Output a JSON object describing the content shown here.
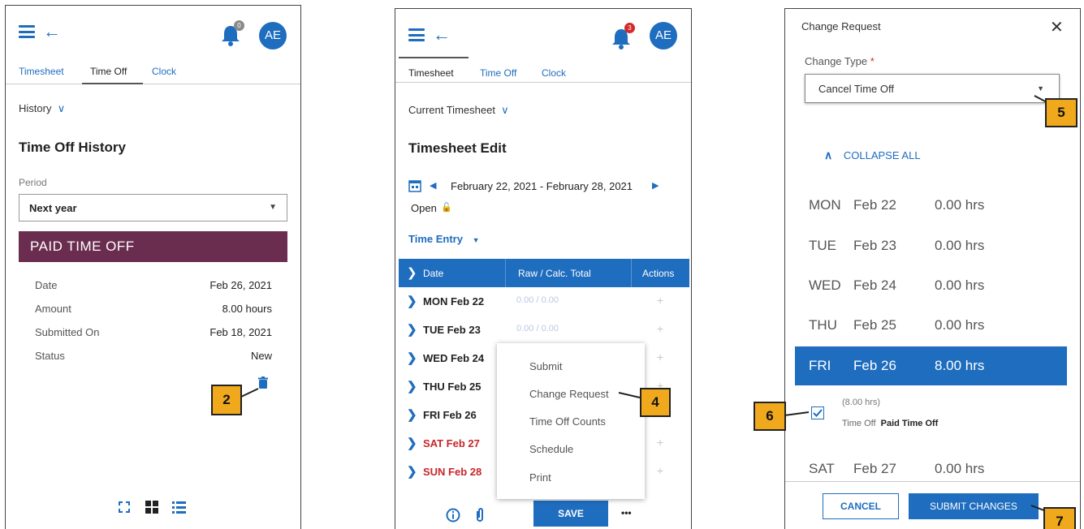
{
  "panel1": {
    "avatar": "AE",
    "bell_badge": "0",
    "tabs": [
      "Timesheet",
      "Time Off",
      "Clock"
    ],
    "history_label": "History",
    "title": "Time Off History",
    "period_label": "Period",
    "period_value": "Next year",
    "card_title": "PAID TIME OFF",
    "details": [
      {
        "label": "Date",
        "value": "Feb 26, 2021"
      },
      {
        "label": "Amount",
        "value": "8.00 hours"
      },
      {
        "label": "Submitted On",
        "value": "Feb 18, 2021"
      },
      {
        "label": "Status",
        "value": "New"
      }
    ],
    "callout": "2"
  },
  "panel2": {
    "avatar": "AE",
    "bell_badge": "3",
    "tabs": [
      "Timesheet",
      "Time Off",
      "Clock"
    ],
    "current_label": "Current Timesheet",
    "title": "Timesheet Edit",
    "date_range": "February 22, 2021 - February 28, 2021",
    "status": "Open",
    "time_entry": "Time Entry",
    "columns": [
      "Date",
      "Raw / Calc. Total",
      "Actions"
    ],
    "rows": [
      {
        "day": "MON Feb 22",
        "total": "0.00 / 0.00"
      },
      {
        "day": "TUE Feb 23",
        "total": "0.00 / 0.00"
      },
      {
        "day": "WED Feb 24",
        "total": ""
      },
      {
        "day": "THU Feb 25",
        "total": ""
      },
      {
        "day": "FRI Feb 26",
        "total": ""
      },
      {
        "day": "SAT Feb 27",
        "total": ""
      },
      {
        "day": "SUN Feb 28",
        "total": ""
      }
    ],
    "menu": [
      "Submit",
      "Change Request",
      "Time Off Counts",
      "Schedule",
      "Print"
    ],
    "save": "SAVE",
    "more": "•••",
    "callout": "4"
  },
  "panel3": {
    "title": "Change Request",
    "change_type_label": "Change Type",
    "required_mark": "*",
    "change_type_value": "Cancel Time Off",
    "collapse": "COLLAPSE ALL",
    "days": [
      {
        "dow": "MON",
        "date": "Feb 22",
        "hrs": "0.00 hrs"
      },
      {
        "dow": "TUE",
        "date": "Feb 23",
        "hrs": "0.00 hrs"
      },
      {
        "dow": "WED",
        "date": "Feb 24",
        "hrs": "0.00 hrs"
      },
      {
        "dow": "THU",
        "date": "Feb 25",
        "hrs": "0.00 hrs"
      },
      {
        "dow": "FRI",
        "date": "Feb 26",
        "hrs": "8.00 hrs"
      }
    ],
    "entry_hours": "(8.00 hrs)",
    "entry_type": "Time Off",
    "entry_name": "Paid Time Off",
    "sat": {
      "dow": "SAT",
      "date": "Feb 27",
      "hrs": "0.00 hrs"
    },
    "cancel": "CANCEL",
    "submit": "SUBMIT CHANGES",
    "callouts": [
      "5",
      "6",
      "7"
    ]
  },
  "colors": {
    "accent": "#1f6dbf",
    "card": "#6b2d4f",
    "callout": "#f0a91d",
    "weekend": "#c7262b"
  }
}
